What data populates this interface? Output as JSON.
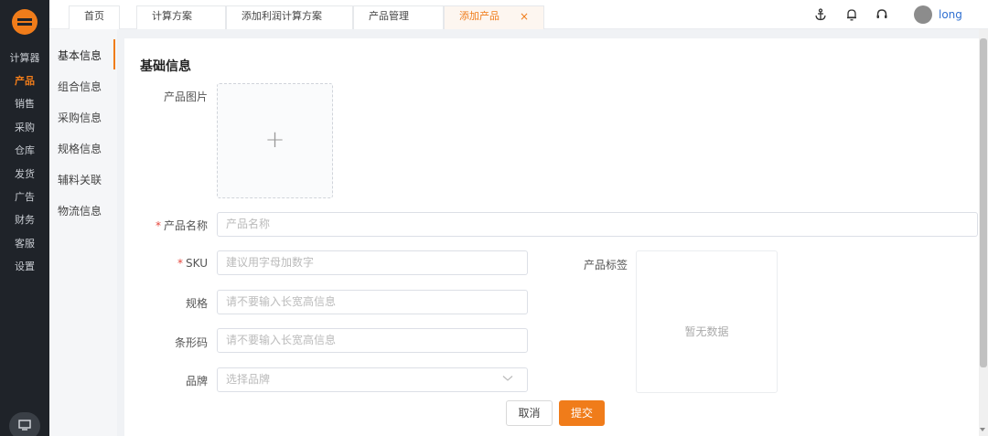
{
  "rail": {
    "items": [
      "计算器",
      "产品",
      "销售",
      "采购",
      "仓库",
      "发货",
      "广告",
      "财务",
      "客服",
      "设置"
    ],
    "active_index": 1
  },
  "tabs": [
    {
      "label": "首页"
    },
    {
      "label": "计算方案"
    },
    {
      "label": "添加利润计算方案"
    },
    {
      "label": "产品管理"
    },
    {
      "label": "添加产品",
      "close": "×"
    }
  ],
  "topbar": {
    "icons": [
      "anchor-icon",
      "bell-icon",
      "headset-icon"
    ],
    "username": "long"
  },
  "subnav": {
    "items": [
      "基本信息",
      "组合信息",
      "采购信息",
      "规格信息",
      "辅料关联",
      "物流信息"
    ],
    "active_index": 0
  },
  "form": {
    "section_title": "基础信息",
    "image_label": "产品图片",
    "upload_symbol": "+",
    "required_mark": "*",
    "name_label": "产品名称",
    "name_placeholder": "产品名称",
    "sku_label": "SKU",
    "sku_placeholder": "建议用字母加数字",
    "spec_label": "规格",
    "spec_placeholder": "请不要输入长宽高信息",
    "barcode_label": "条形码",
    "barcode_placeholder": "请不要输入长宽高信息",
    "brand_label": "品牌",
    "brand_placeholder": "选择品牌",
    "tags_label": "产品标签",
    "tags_empty": "暂无数据"
  },
  "buttons": {
    "cancel": "取消",
    "submit": "提交"
  },
  "colors": {
    "accent": "#f07c1a",
    "rail_bg": "#1f2329",
    "link": "#2f6fd1"
  }
}
